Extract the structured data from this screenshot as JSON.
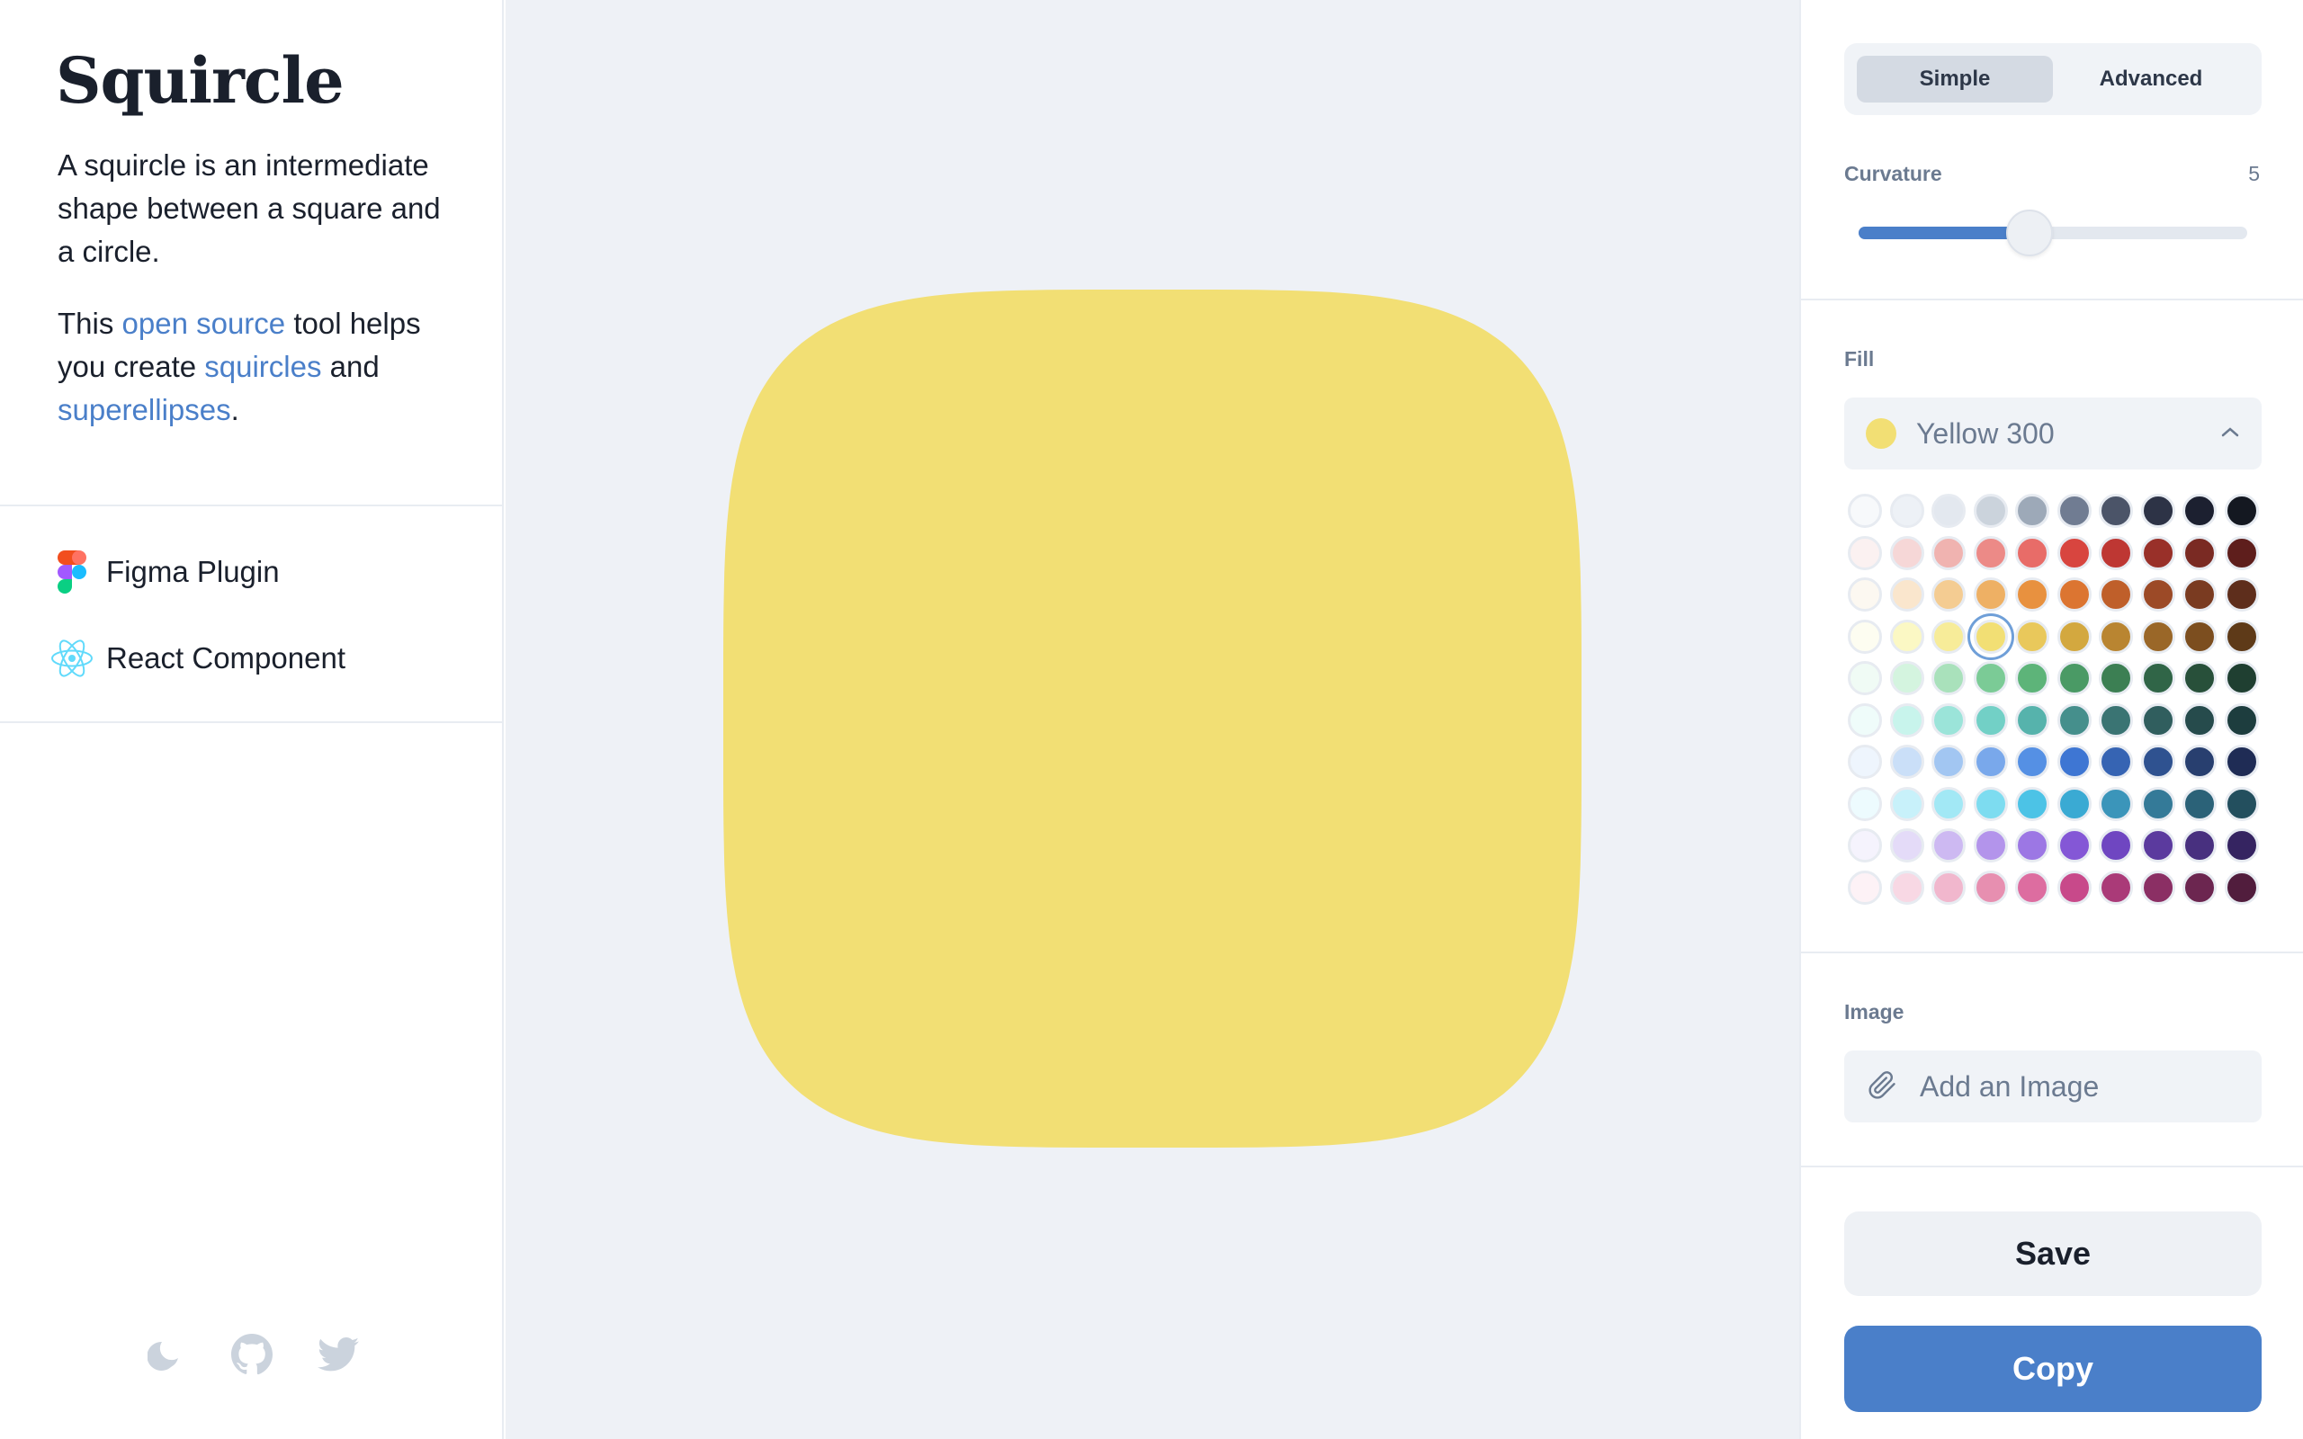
{
  "sidebar": {
    "title": "Squircle",
    "intro": "A squircle is an intermediate shape between a square and a circle.",
    "tool_prefix": "This ",
    "open_source_link": "open source",
    "tool_middle": " tool helps you create ",
    "squircles_link": "squircles",
    "and_text": " and ",
    "superellipses_link": "superellipses",
    "period": ".",
    "links": [
      {
        "label": "Figma Plugin",
        "icon": "figma-icon"
      },
      {
        "label": "React Component",
        "icon": "react-icon"
      }
    ],
    "footer_icons": [
      "moon-icon",
      "github-icon",
      "twitter-icon"
    ]
  },
  "canvas": {
    "shape_color": "#F2DF74"
  },
  "panel": {
    "mode_tabs": [
      "Simple",
      "Advanced"
    ],
    "active_mode": "Simple",
    "curvature_label": "Curvature",
    "curvature_value": "5",
    "curvature_fraction": 0.44,
    "fill_label": "Fill",
    "fill_selected": "Yellow 300",
    "fill_selected_color": "#F2DF74",
    "selected_swatch": {
      "row": 3,
      "col": 3
    },
    "palette": [
      [
        "#F7F9FB",
        "#EDF1F6",
        "#E3E8EF",
        "#CBD3DC",
        "#9DA9B8",
        "#707C92",
        "#4B5468",
        "#2D3346",
        "#1C2030",
        "#141821"
      ],
      [
        "#FBF1F1",
        "#F6D7D7",
        "#F0B3B0",
        "#EC8A87",
        "#E86C68",
        "#D8453F",
        "#BE3733",
        "#993029",
        "#7A2A23",
        "#5E1E1C"
      ],
      [
        "#FCF8F1",
        "#FAE6CD",
        "#F4CC92",
        "#EEB064",
        "#E8913F",
        "#DC7531",
        "#BF5F2A",
        "#9C4A27",
        "#7A3B21",
        "#5E2E1C"
      ],
      [
        "#FDFDF1",
        "#FBF8C4",
        "#F7EC99",
        "#F2DF74",
        "#E9C85B",
        "#D3A83F",
        "#B98531",
        "#9A6728",
        "#7C4E1F",
        "#5E3A18"
      ],
      [
        "#F0FBF5",
        "#D4F4DF",
        "#A9E1BB",
        "#7BCB96",
        "#5DB479",
        "#4A9A65",
        "#3C7F53",
        "#306547",
        "#28503A",
        "#1F3F31"
      ],
      [
        "#EFFCFA",
        "#C8F4EC",
        "#9BE4D9",
        "#72D0C6",
        "#56B3AC",
        "#458F8C",
        "#3A7473",
        "#305E5E",
        "#264B4C",
        "#1D3D3E"
      ],
      [
        "#EEF5FD",
        "#CADFF8",
        "#A2C6F2",
        "#79A8EB",
        "#5590E4",
        "#3E76D3",
        "#3664B3",
        "#2F5290",
        "#283F6F",
        "#1F2C55"
      ],
      [
        "#EDFBFE",
        "#C8F1FA",
        "#A2E8F5",
        "#7DDCF0",
        "#4CC3E6",
        "#3AAAD3",
        "#3B95BA",
        "#347A98",
        "#2B6278",
        "#234F5E"
      ],
      [
        "#F5F3FD",
        "#E4DBF8",
        "#CDB9F2",
        "#B394EB",
        "#9C77E4",
        "#8457D6",
        "#6F46C1",
        "#5B3A9E",
        "#48307F",
        "#352461"
      ],
      [
        "#FDF2F6",
        "#F8D8E4",
        "#F1B7CD",
        "#E78FB0",
        "#DD6DA0",
        "#C8498A",
        "#AA3A78",
        "#8B2F64",
        "#6C2650",
        "#511D3D"
      ]
    ],
    "image_label": "Image",
    "image_placeholder": "Add an Image",
    "save_label": "Save",
    "copy_label": "Copy"
  }
}
